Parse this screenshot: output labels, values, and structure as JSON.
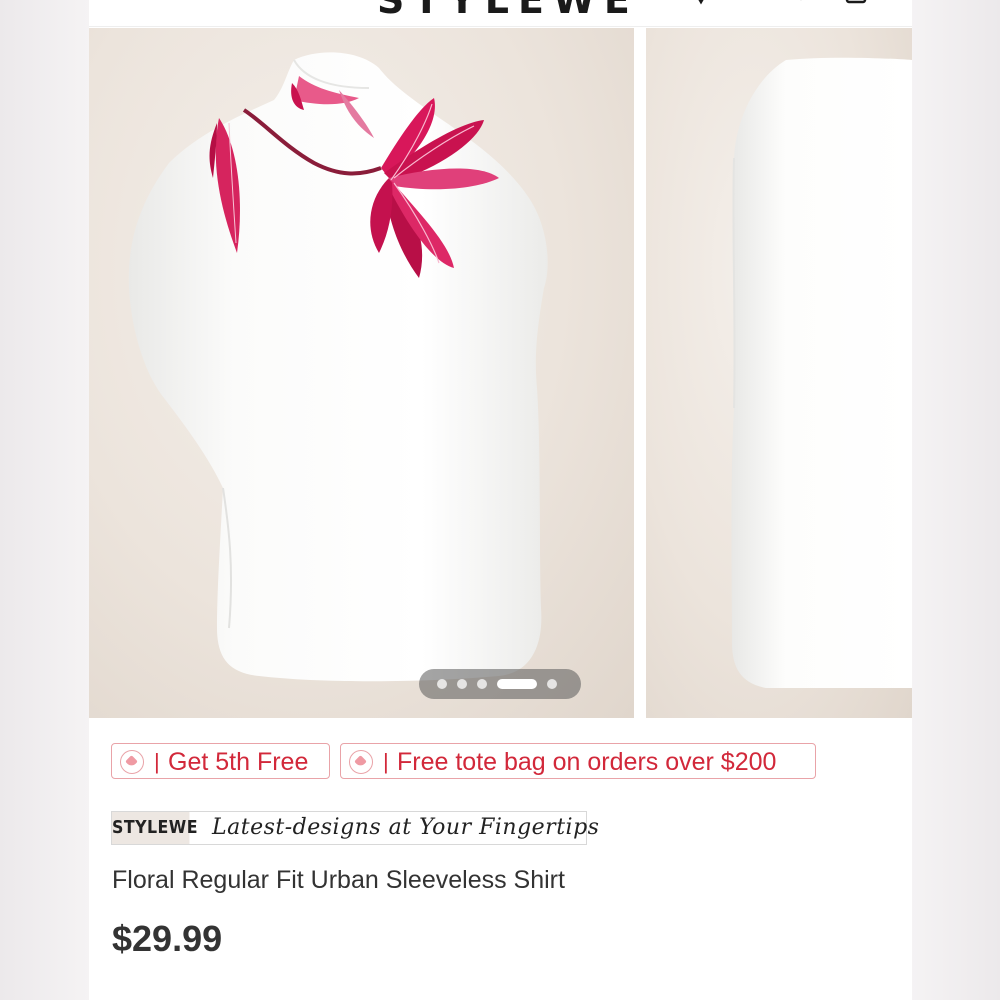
{
  "header": {
    "logo_text": "STYLEWE",
    "icons": [
      "search-icon",
      "user-icon",
      "bag-icon"
    ]
  },
  "gallery": {
    "slide_count": 5,
    "active_slide": 4,
    "front_image": "white asymmetric sleeveless top with red lily print",
    "back_image": "white sleeveless top back view"
  },
  "promos": [
    {
      "label": "Get 5th Free",
      "icon": "tag-icon"
    },
    {
      "label": "Free tote bag on orders over $200",
      "icon": "tag-icon"
    }
  ],
  "brand_banner": {
    "brand": "STYLEWE",
    "slogan": "Latest-designs at Your Fingertips"
  },
  "product": {
    "title": "Floral Regular Fit Urban Sleeveless Shirt",
    "price": "$29.99"
  },
  "colors": {
    "promo_red": "#d2283a",
    "promo_border": "#e9a3a8",
    "print_pink": "#d8175a",
    "brand_bg": "#ede7e2"
  }
}
